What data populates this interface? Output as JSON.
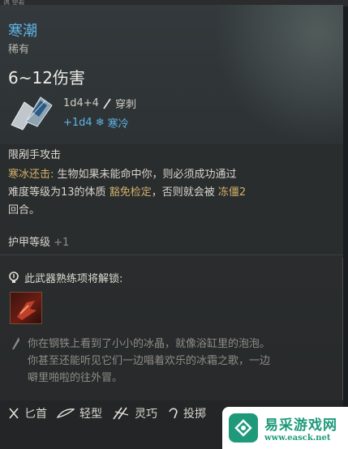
{
  "top_strip": {
    "text": "遇 望看"
  },
  "item": {
    "name": "寒潮",
    "rarity": "稀有",
    "damage": "6~12伤害",
    "icon": "ice-dagger-icon"
  },
  "damage_rolls": [
    {
      "dice": "1d4+4",
      "icon": "pierce-icon",
      "type": "穿刺"
    },
    {
      "dice": "+1d4",
      "icon": "cold-icon",
      "type": "寒冷"
    }
  ],
  "properties": {
    "restriction": "限剐手攻击",
    "ability_name": "寒冰还击:",
    "ability_text_1": " 生物如果未能命中你，则必须成功通过",
    "ability_text_2": "难度等级为13的体质 ",
    "save_kw": "豁免检定",
    "ability_text_3": "，否则就会被 ",
    "status_kw": "冻僵2",
    "ability_text_4": "回合。",
    "ac_label": "护甲等级",
    "ac_value": "+1"
  },
  "proficiency": {
    "label": "此武器熟练项将解锁:",
    "icon": "bulb-icon",
    "skill_icon": "proficiency-skill-icon"
  },
  "flavor": {
    "line1": "你在钢铁上看到了小小的冰晶，就像浴缸里的泡泡。",
    "line2": "你甚至还能听见它们一边唱着欢乐的冰霜之歌，一边",
    "line3": "噼里啪啦的往外冒。"
  },
  "traits": [
    {
      "icon": "dagger-icon",
      "label": "匕首"
    },
    {
      "icon": "feather-icon",
      "label": "轻型"
    },
    {
      "icon": "finesse-icon",
      "label": "灵巧"
    },
    {
      "icon": "thrown-icon",
      "label": "投掷"
    }
  ],
  "watermark": {
    "name": "易采游戏网",
    "url": "www.easck.net"
  },
  "colors": {
    "name_blue": "#5fb5e6",
    "keyword_gold": "#d2b06a",
    "logo_green": "#1e9a7a"
  }
}
